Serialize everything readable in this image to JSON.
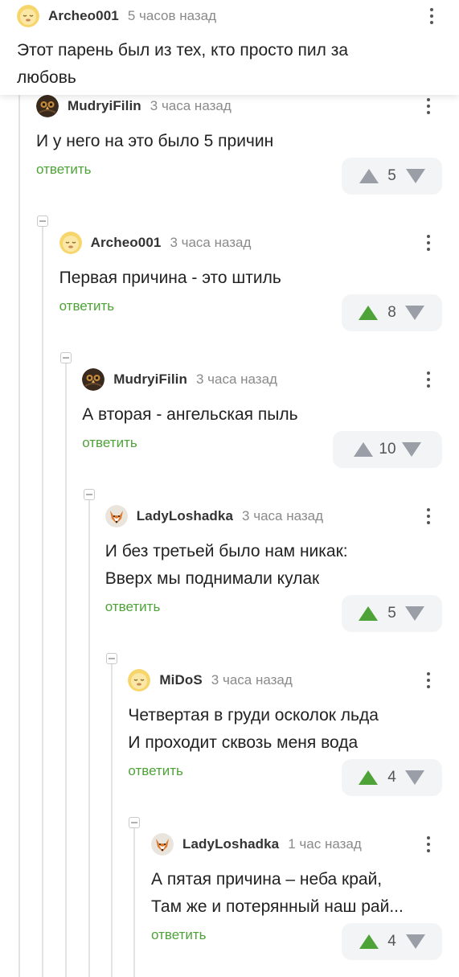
{
  "top_comment": {
    "author": "Archeo001",
    "time": "5 часов назад",
    "avatar_icon": "sleeping-face-icon",
    "text": "Этот парень был из тех, кто просто пил за любовь"
  },
  "reply_label": "ответить",
  "colors": {
    "reply": "#4ea338",
    "upvote_active": "#4ea338",
    "vote_inactive": "#9a9ea6",
    "vote_bg": "#f3f4f6",
    "thread_line": "#e3e3e3"
  },
  "comments": [
    {
      "author": "MudryiFilin",
      "time": "3 часа назад",
      "avatar_icon": "owl-avatar-icon",
      "lines": [
        "И у него на это было 5 причин"
      ],
      "rating": "5",
      "upvoted": false
    },
    {
      "author": "Archeo001",
      "time": "3 часа назад",
      "avatar_icon": "sleeping-face-icon",
      "lines": [
        "Первая причина - это штиль"
      ],
      "rating": "8",
      "upvoted": true
    },
    {
      "author": "MudryiFilin",
      "time": "3 часа назад",
      "avatar_icon": "owl-avatar-icon",
      "lines": [
        "А вторая - ангельская пыль"
      ],
      "rating": "10",
      "upvoted": false
    },
    {
      "author": "LadyLoshadka",
      "time": "3 часа назад",
      "avatar_icon": "fox-avatar-icon",
      "lines": [
        "И без третьей было нам никак:",
        "Вверх мы поднимали кулак"
      ],
      "rating": "5",
      "upvoted": true
    },
    {
      "author": "MiDoS",
      "time": "3 часа назад",
      "avatar_icon": "sleeping-face-icon",
      "lines": [
        "Четвертая в груди осколок льда",
        "И проходит сквозь меня вода"
      ],
      "rating": "4",
      "upvoted": true
    },
    {
      "author": "LadyLoshadka",
      "time": "1 час назад",
      "avatar_icon": "fox-avatar-icon",
      "lines": [
        "А пятая причина – неба край,",
        "Там же и потерянный наш рай..."
      ],
      "rating": "4",
      "upvoted": true
    }
  ]
}
